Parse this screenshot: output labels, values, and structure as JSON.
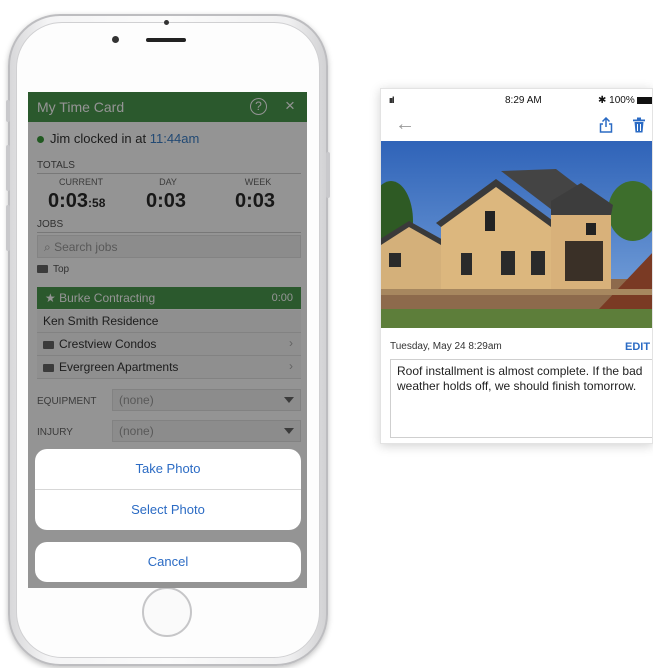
{
  "left_phone": {
    "app_title": "My Time Card",
    "help_icon": "?",
    "close_icon": "×",
    "clocked_in_prefix": "Jim clocked in at",
    "clocked_in_time": "11:44am",
    "totals_label": "TOTALS",
    "totals": {
      "current_label": "CURRENT",
      "current_value": "0:03",
      "current_seconds": ":58",
      "day_label": "DAY",
      "day_value": "0:03",
      "week_label": "WEEK",
      "week_value": "0:03"
    },
    "jobs_label": "JOBS",
    "search_placeholder": "Search jobs",
    "top_folder_label": "Top",
    "active_job": {
      "name": "Burke Contracting",
      "time": "0:00"
    },
    "jobs": [
      {
        "name": "Ken Smith Residence",
        "has_folder": false,
        "has_chevron": false
      },
      {
        "name": "Crestview Condos",
        "has_folder": true,
        "has_chevron": true
      },
      {
        "name": "Evergreen Apartments",
        "has_folder": true,
        "has_chevron": true
      }
    ],
    "equipment_label": "EQUIPMENT",
    "equipment_value": "(none)",
    "injury_label": "INJURY",
    "injury_value": "(none)",
    "action_sheet": {
      "take_photo": "Take Photo",
      "select_photo": "Select Photo",
      "cancel": "Cancel"
    }
  },
  "right_phone": {
    "status_time": "8:29 AM",
    "battery": "100%",
    "signal": "ııl",
    "back_icon": "←",
    "date_text": "Tuesday, May 24 8:29am",
    "edit_label": "EDIT",
    "note_text": "Roof installment is almost complete. If the bad weather holds off, we should finish tomorrow."
  },
  "colors": {
    "accent_green": "#4a9a4f",
    "link_blue": "#2b6bc4",
    "status_dot_green": "#3a9a3a"
  }
}
